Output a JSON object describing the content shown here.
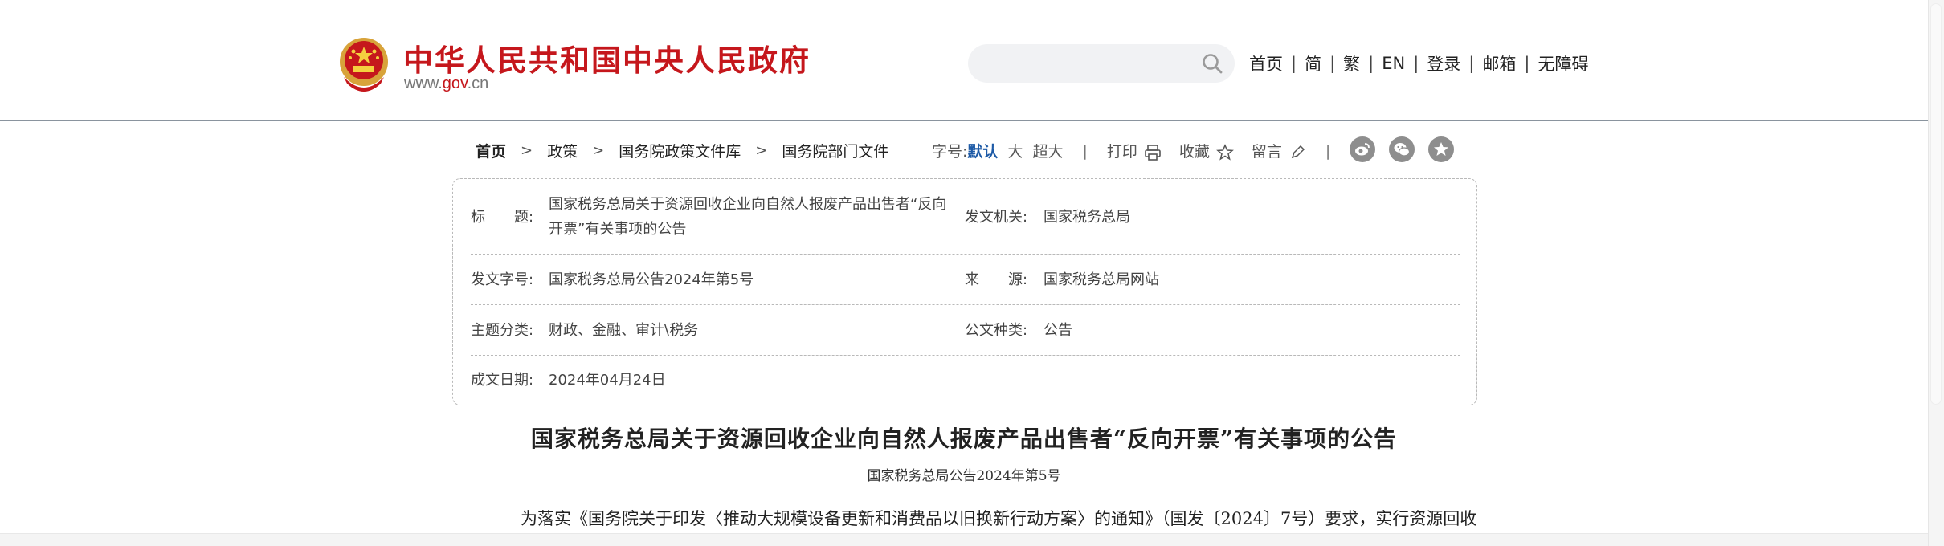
{
  "header": {
    "site_title": "中华人民共和国中央人民政府",
    "url_prefix": "www.",
    "url_gov": "gov",
    "url_suffix": ".cn",
    "brand_color": "#c5171c",
    "search": {
      "placeholder": "",
      "value": ""
    },
    "nav": [
      "首页",
      "简",
      "繁",
      "EN",
      "登录",
      "邮箱",
      "无障碍"
    ],
    "nav_separator": "|"
  },
  "breadcrumb": {
    "items": [
      "首页",
      "政策",
      "国务院政策文件库",
      "国务院部门文件"
    ],
    "separator": ">"
  },
  "tools": {
    "font_label": "字号:",
    "font_sizes": [
      "默认",
      "大",
      "超大"
    ],
    "print": "打印",
    "favorite": "收藏",
    "comment": "留言",
    "separator": "|",
    "share_icons": [
      "weibo-icon",
      "wechat-icon",
      "favorite-star-icon"
    ]
  },
  "info": {
    "title_label": "标　　题:",
    "title_value": "国家税务总局关于资源回收企业向自然人报废产品出售者“反向开票”有关事项的公告",
    "issuer_label": "发文机关:",
    "issuer_value": "国家税务总局",
    "doc_no_label": "发文字号:",
    "doc_no_value": "国家税务总局公告2024年第5号",
    "source_label": "来　　源:",
    "source_value": "国家税务总局网站",
    "topic_label": "主题分类:",
    "topic_value": "财政、金融、审计\\税务",
    "type_label": "公文种类:",
    "type_value": "公告",
    "date_label": "成文日期:",
    "date_value": "2024年04月24日"
  },
  "article": {
    "title": "国家税务总局关于资源回收企业向自然人报废产品出售者“反向开票”有关事项的公告",
    "subtitle": "国家税务总局公告2024年第5号",
    "first_line": "为落实《国务院关于印发〈推动大规模设备更新和消费品以旧换新行动方案〉的通知》（国发〔2024〕7号）要求，实行资源回收"
  }
}
